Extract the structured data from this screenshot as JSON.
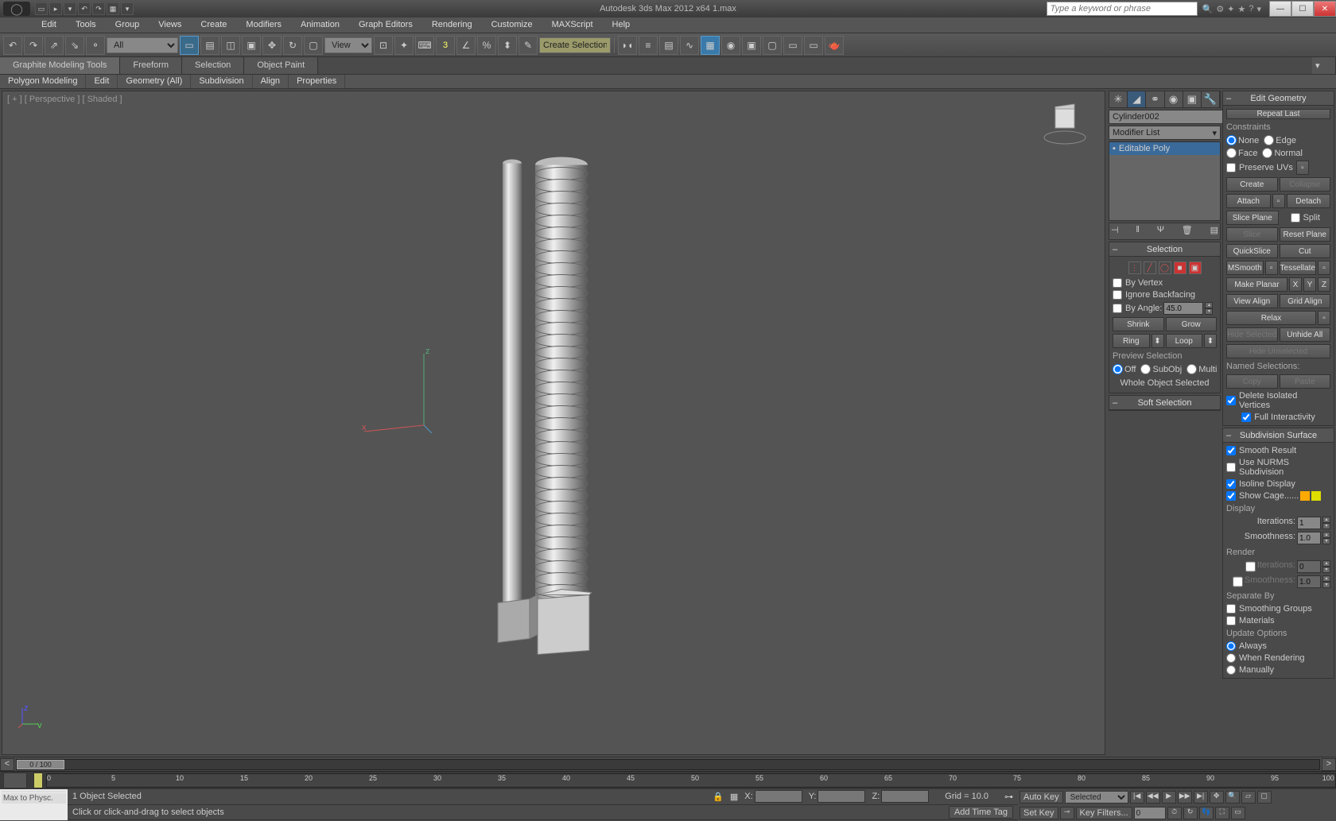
{
  "title": "Autodesk 3ds Max 2012 x64    1.max",
  "search_placeholder": "Type a keyword or phrase",
  "menu": [
    "Edit",
    "Tools",
    "Group",
    "Views",
    "Create",
    "Modifiers",
    "Animation",
    "Graph Editors",
    "Rendering",
    "Customize",
    "MAXScript",
    "Help"
  ],
  "toolbar": {
    "set_filter": "All",
    "ref_coord": "View",
    "axis_num": "3",
    "create_sel": "Create Selection Se"
  },
  "ribbon_tabs": [
    "Graphite Modeling Tools",
    "Freeform",
    "Selection",
    "Object Paint"
  ],
  "ribbon_sub": [
    "Polygon Modeling",
    "Edit",
    "Geometry (All)",
    "Subdivision",
    "Align",
    "Properties"
  ],
  "viewport_label": "[ + ] [ Perspective ] [ Shaded ]",
  "object_name": "Cylinder002",
  "modifier_list": "Modifier List",
  "mod_stack_item": "Editable Poly",
  "selection": {
    "header": "Selection",
    "by_vertex": "By Vertex",
    "ignore_backfacing": "Ignore Backfacing",
    "by_angle": "By Angle:",
    "angle_val": "45.0",
    "shrink": "Shrink",
    "grow": "Grow",
    "ring": "Ring",
    "loop": "Loop",
    "preview": "Preview Selection",
    "off": "Off",
    "subobj": "SubObj",
    "multi": "Multi",
    "whole_selected": "Whole Object Selected"
  },
  "soft_sel": "Soft Selection",
  "edit_geom": {
    "header": "Edit Geometry",
    "repeat_last": "Repeat Last",
    "constraints": "Constraints",
    "none": "None",
    "edge": "Edge",
    "face": "Face",
    "normal": "Normal",
    "preserve_uvs": "Preserve UVs",
    "create": "Create",
    "collapse": "Collapse",
    "attach": "Attach",
    "detach": "Detach",
    "slice_plane": "Slice Plane",
    "split": "Split",
    "slice": "Slice",
    "reset_plane": "Reset Plane",
    "quickslice": "QuickSlice",
    "cut": "Cut",
    "msmooth": "MSmooth",
    "tessellate": "Tessellate",
    "make_planar": "Make Planar",
    "x": "X",
    "y": "Y",
    "z": "Z",
    "view_align": "View Align",
    "grid_align": "Grid Align",
    "relax": "Relax",
    "hide_sel": "Hide Selected",
    "unhide_all": "Unhide All",
    "hide_unsel": "Hide Unselected",
    "named_sel": "Named Selections:",
    "copy": "Copy",
    "paste": "Paste",
    "del_iso": "Delete Isolated Vertices",
    "full_int": "Full Interactivity"
  },
  "subdiv": {
    "header": "Subdivision Surface",
    "smooth_result": "Smooth Result",
    "use_nurms": "Use NURMS Subdivision",
    "isoline": "Isoline Display",
    "show_cage": "Show Cage......",
    "display": "Display",
    "iterations": "Iterations:",
    "iter_val": "1",
    "smoothness": "Smoothness:",
    "smooth_val": "1.0",
    "render": "Render",
    "r_iter_val": "0",
    "r_smooth_val": "1.0",
    "separate_by": "Separate By",
    "smoothing_groups": "Smoothing Groups",
    "materials": "Materials",
    "update_options": "Update Options",
    "always": "Always",
    "when_rendering": "When Rendering",
    "manually": "Manually"
  },
  "timeslider": {
    "label": "0 / 100"
  },
  "trackbar_ticks": [
    "0",
    "5",
    "10",
    "15",
    "20",
    "25",
    "30",
    "35",
    "40",
    "45",
    "50",
    "55",
    "60",
    "65",
    "70",
    "75",
    "80",
    "85",
    "90",
    "95",
    "100"
  ],
  "status": {
    "script1": "",
    "script2": "Max to Physc.",
    "obj_sel": "1 Object Selected",
    "prompt": "Click or click-and-drag to select objects",
    "x": "X:",
    "y": "Y:",
    "z": "Z:",
    "grid": "Grid = 10.0",
    "autokey": "Auto Key",
    "selected": "Selected",
    "setkey": "Set Key",
    "keyfilters": "Key Filters...",
    "add_time_tag": "Add Time Tag"
  }
}
